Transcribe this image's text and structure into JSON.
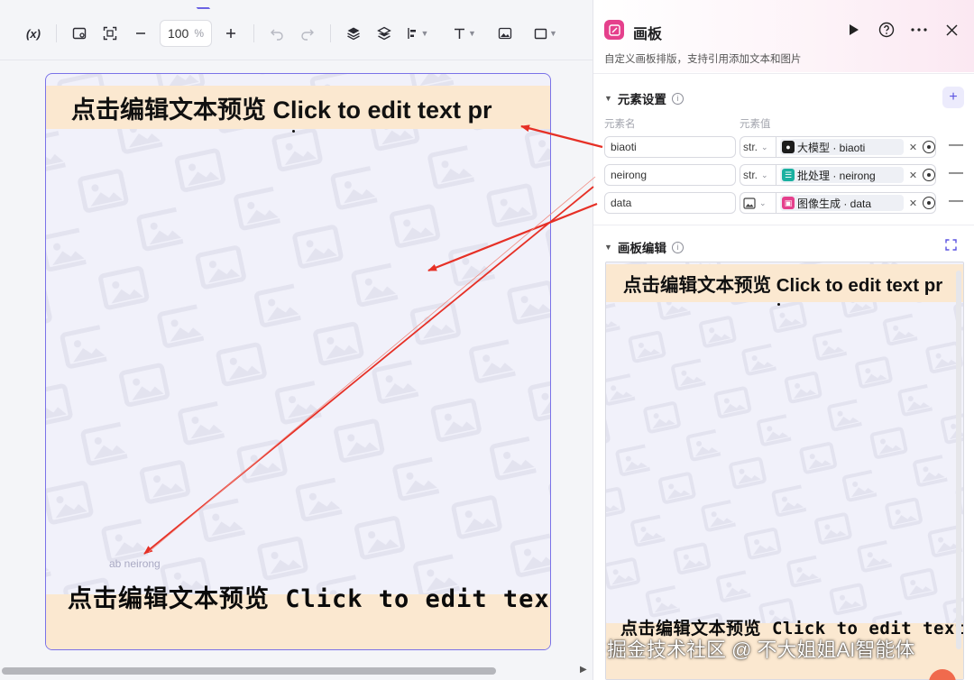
{
  "toolbar": {
    "variable_label": "(x)",
    "zoom_value": "100",
    "zoom_unit": "%"
  },
  "canvas": {
    "title_text": "点击编辑文本预览 Click to edit text pr",
    "small_tag": "ab neirong",
    "bottom_text": "点击编辑文本预览 Click to edit text p"
  },
  "panel": {
    "title": "画板",
    "description": "自定义画板排版，支持引用添加文本和图片",
    "elements_section": "元素设置",
    "col_name": "元素名",
    "col_value": "元素值",
    "rows": [
      {
        "name": "biaoti",
        "type": "str.",
        "ref": "大模型 · biaoti",
        "ref_color": "#1c1c1c",
        "ref_icon": "robot-icon"
      },
      {
        "name": "neirong",
        "type": "str.",
        "ref": "批处理 · neirong",
        "ref_color": "#1ab0a0",
        "ref_icon": "batch-icon"
      },
      {
        "name": "data",
        "type": "",
        "ref": "图像生成 · data",
        "ref_color": "#e5408c",
        "ref_icon": "image-gen-icon"
      }
    ],
    "canvas_section": "画板编辑",
    "mini_title": "点击编辑文本预览 Click to edit text pr",
    "mini_bottom": "点击编辑文本预览 Click to edit text p"
  },
  "watermark": "掘金技术社区 @ 不大姐姐AI智能体",
  "colors": {
    "accent": "#6b63e3",
    "highlight_band": "#fbe8d0",
    "arrow": "#e63026"
  }
}
